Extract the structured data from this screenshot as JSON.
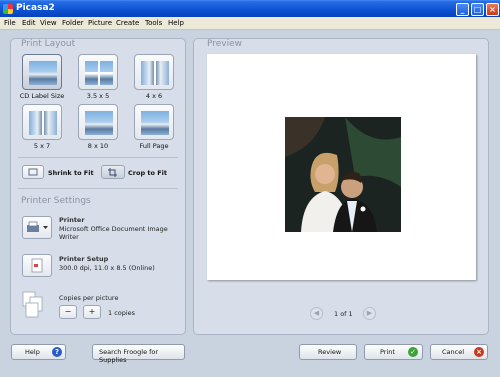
{
  "window": {
    "title": "Picasa2"
  },
  "menu": [
    "File",
    "Edit",
    "View",
    "Folder",
    "Picture",
    "Create",
    "Tools",
    "Help"
  ],
  "print_layout": {
    "heading": "Print Layout",
    "options": [
      {
        "label": "CD Label Size",
        "selected": true
      },
      {
        "label": "3.5 x 5",
        "selected": false
      },
      {
        "label": "4 x 6",
        "selected": false
      },
      {
        "label": "5 x 7",
        "selected": false
      },
      {
        "label": "8 x 10",
        "selected": false
      },
      {
        "label": "Full Page",
        "selected": false
      }
    ],
    "shrink_label": "Shrink to Fit",
    "crop_label": "Crop to Fit",
    "fit_mode": "crop"
  },
  "printer_settings": {
    "heading": "Printer Settings",
    "printer_title": "Printer",
    "printer_name_line1": "Microsoft Office Document Image",
    "printer_name_line2": "Writer",
    "setup_title": "Printer Setup",
    "setup_details": "300.0 dpi, 11.0 x 8.5 (Online)",
    "copies_title": "Copies per picture",
    "minus": "−",
    "plus": "+",
    "copies_value": "1 copies"
  },
  "preview": {
    "heading": "Preview",
    "page_indicator": "1 of 1",
    "prev_glyph": "◀",
    "next_glyph": "▶"
  },
  "buttons": {
    "help": "Help",
    "search": "Search Froogle for Supplies",
    "review": "Review",
    "print": "Print",
    "cancel": "Cancel"
  },
  "colors": {
    "title_bar": "#0a4fd0",
    "print_ok": "#3aa33a",
    "cancel_x": "#c8391b",
    "help_q": "#2a5cc8"
  }
}
